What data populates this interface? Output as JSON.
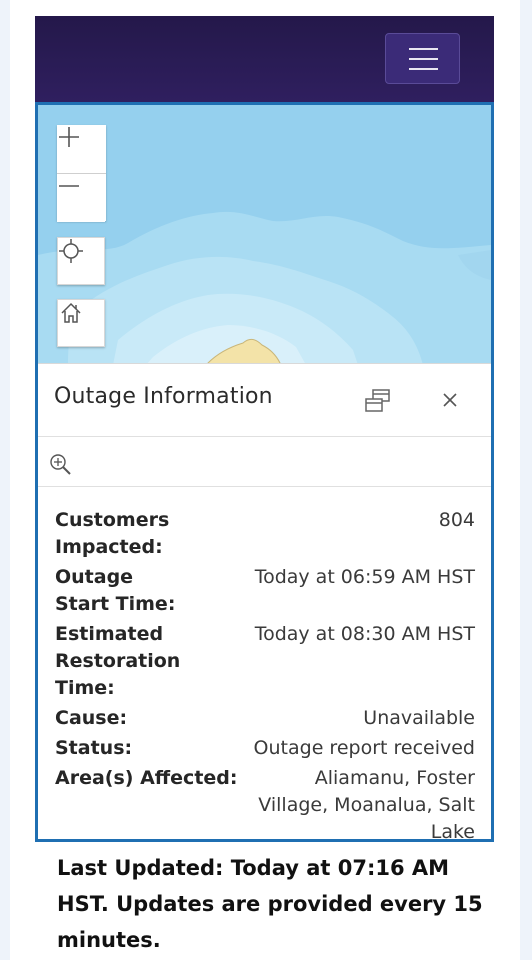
{
  "header": {
    "menu_icon": "hamburger-menu-icon",
    "bg_color": "#2a1c55"
  },
  "map": {
    "controls": {
      "zoom_in_icon": "plus-icon",
      "zoom_out_icon": "minus-icon",
      "locate_icon": "crosshair-icon",
      "home_icon": "home-icon"
    },
    "water_color": "#95d0ee",
    "land_color": "#f3e3a8"
  },
  "panel": {
    "title": "Outage Information",
    "dock_icon": "dock-icon",
    "close_icon": "close-icon",
    "zoom_to_icon": "zoom-to-icon",
    "fields": [
      {
        "label": "Customers Impacted:",
        "value": "804"
      },
      {
        "label": "Outage Start Time:",
        "value": "Today at 06:59 AM HST"
      },
      {
        "label": "Estimated Restoration Time:",
        "value": "Today at 08:30 AM HST"
      },
      {
        "label": "Cause:",
        "value": "Unavailable"
      },
      {
        "label": "Status:",
        "value": "Outage report received"
      },
      {
        "label": "Area(s) Affected:",
        "value": "Aliamanu, Foster Village, Moanalua, Salt Lake"
      }
    ]
  },
  "footer": {
    "text": "Last Updated: Today at 07:16 AM HST. Updates are provided every 15 minutes."
  }
}
